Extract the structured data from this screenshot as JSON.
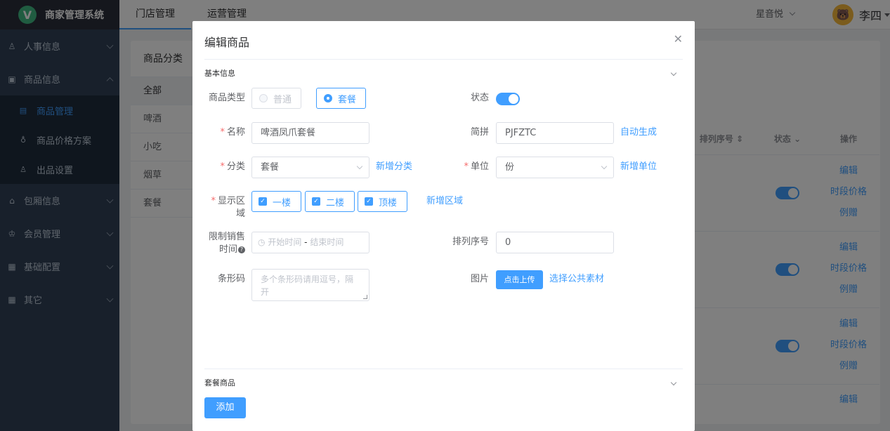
{
  "app": {
    "logo_letter": "V",
    "title": "商家管理系统",
    "top_nav": [
      "门店管理",
      "运营管理"
    ],
    "store": "星音悦",
    "user": "李四",
    "avatar_glyph": "🐻"
  },
  "sidebar": {
    "items": [
      {
        "label": "人事信息",
        "icon": "person-icon"
      },
      {
        "label": "商品信息",
        "icon": "goods-icon"
      },
      {
        "label": "包厢信息",
        "icon": "home-icon"
      },
      {
        "label": "会员管理",
        "icon": "crown-icon"
      },
      {
        "label": "基础配置",
        "icon": "grid-icon"
      },
      {
        "label": "其它",
        "icon": "grid-icon"
      }
    ],
    "submenu": [
      {
        "label": "商品管理",
        "icon": "list-icon"
      },
      {
        "label": "商品价格方案",
        "icon": "money-bag-icon"
      },
      {
        "label": "出品设置",
        "icon": "person-icon"
      }
    ]
  },
  "background": {
    "category_title": "商品分类",
    "categories": [
      "全部",
      "啤酒",
      "小吃",
      "烟草",
      "套餐"
    ],
    "table_headers": [
      "排列序号",
      "状态",
      "操作"
    ],
    "row_actions": [
      "编辑",
      "时段价格",
      "例赠"
    ],
    "last_row_action": "编辑"
  },
  "dialog": {
    "title": "编辑商品",
    "section_basic": "基本信息",
    "section_combo": "套餐商品",
    "labels": {
      "type": "商品类型",
      "status": "状态",
      "name": "名称",
      "pinyin": "简拼",
      "category": "分类",
      "unit": "单位",
      "area": "显示区域",
      "time_limit_1": "限制销售",
      "time_limit_2": "时间",
      "sort": "排列序号",
      "barcode": "条形码",
      "image": "图片"
    },
    "type_options": [
      "普通",
      "套餐"
    ],
    "type_selected": "套餐",
    "status_on": true,
    "name_value": "啤酒凤爪套餐",
    "pinyin_value": "PJFZTC",
    "auto_generate": "自动生成",
    "category_value": "套餐",
    "add_category": "新增分类",
    "unit_value": "份",
    "add_unit": "新增单位",
    "areas": [
      "一楼",
      "二楼",
      "顶楼"
    ],
    "add_area": "新增区域",
    "time_start_placeholder": "开始时间",
    "time_sep": "-",
    "time_end_placeholder": "结束时间",
    "sort_value": "0",
    "barcode_placeholder": "多个条形码请用逗号，隔开",
    "upload_button": "点击上传",
    "choose_public": "选择公共素材",
    "add_button": "添加"
  }
}
